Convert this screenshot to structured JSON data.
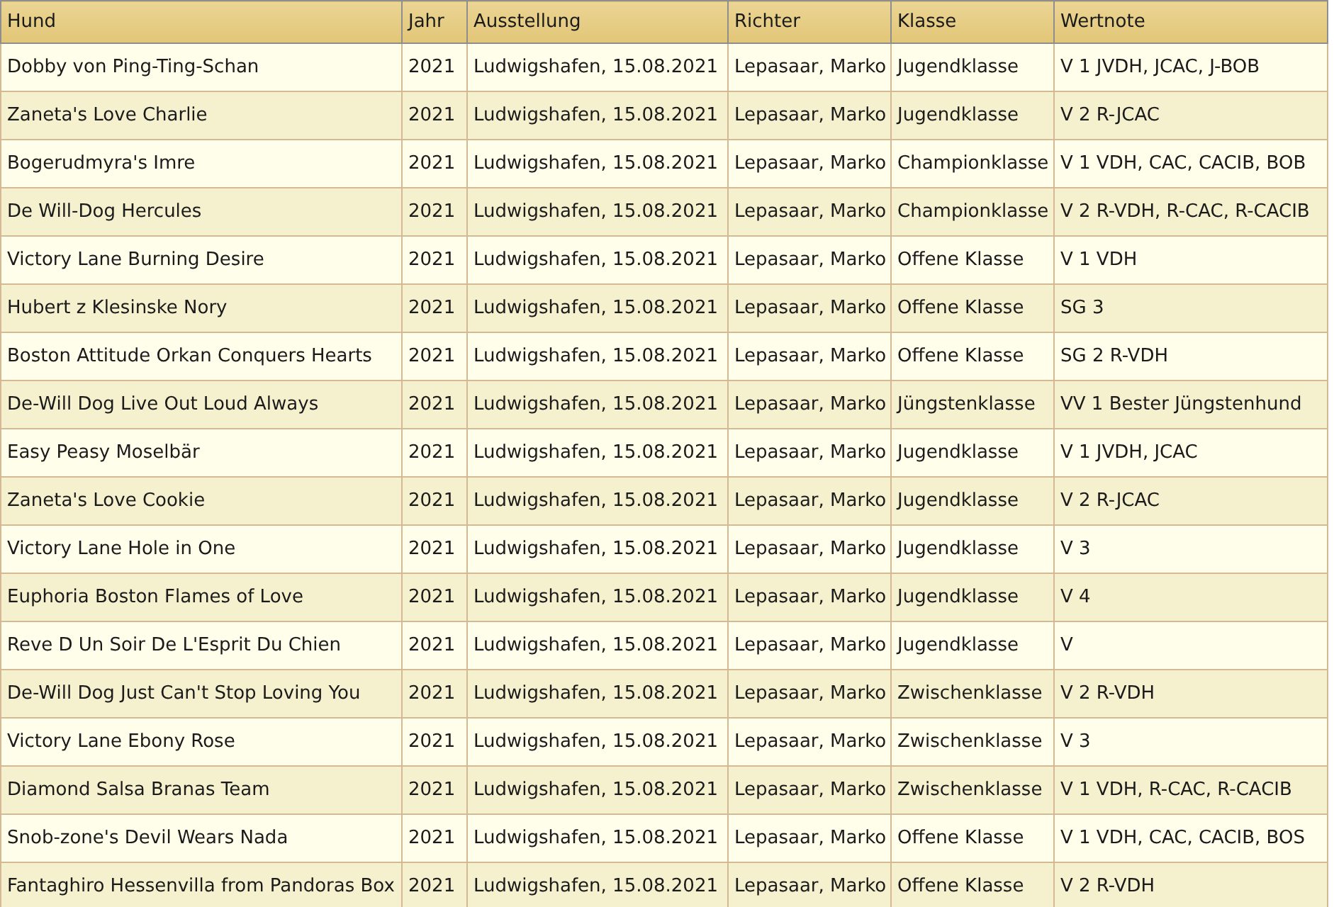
{
  "table": {
    "columns": [
      "Hund",
      "Jahr",
      "Ausstellung",
      "Richter",
      "Klasse",
      "Wertnote"
    ],
    "rows": [
      [
        "Dobby von Ping-Ting-Schan",
        "2021",
        "Ludwigshafen, 15.08.2021",
        "Lepasaar, Marko",
        "Jugendklasse",
        "V 1 JVDH, JCAC, J-BOB"
      ],
      [
        "Zaneta's Love Charlie",
        "2021",
        "Ludwigshafen, 15.08.2021",
        "Lepasaar, Marko",
        "Jugendklasse",
        "V 2 R-JCAC"
      ],
      [
        "Bogerudmyra's Imre",
        "2021",
        "Ludwigshafen, 15.08.2021",
        "Lepasaar, Marko",
        "Championklasse",
        "V 1 VDH, CAC, CACIB, BOB"
      ],
      [
        "De Will-Dog Hercules",
        "2021",
        "Ludwigshafen, 15.08.2021",
        "Lepasaar, Marko",
        "Championklasse",
        "V 2 R-VDH, R-CAC, R-CACIB"
      ],
      [
        "Victory Lane Burning Desire",
        "2021",
        "Ludwigshafen, 15.08.2021",
        "Lepasaar, Marko",
        "Offene Klasse",
        "V 1 VDH"
      ],
      [
        "Hubert z Klesinske Nory",
        "2021",
        "Ludwigshafen, 15.08.2021",
        "Lepasaar, Marko",
        "Offene Klasse",
        "SG 3"
      ],
      [
        "Boston Attitude Orkan Conquers Hearts",
        "2021",
        "Ludwigshafen, 15.08.2021",
        "Lepasaar, Marko",
        "Offene Klasse",
        "SG 2 R-VDH"
      ],
      [
        "De-Will Dog Live Out Loud Always",
        "2021",
        "Ludwigshafen, 15.08.2021",
        "Lepasaar, Marko",
        "Jüngstenklasse",
        "VV 1 Bester Jüngstenhund"
      ],
      [
        "Easy Peasy Moselbär",
        "2021",
        "Ludwigshafen, 15.08.2021",
        "Lepasaar, Marko",
        "Jugendklasse",
        "V 1 JVDH, JCAC"
      ],
      [
        "Zaneta's Love Cookie",
        "2021",
        "Ludwigshafen, 15.08.2021",
        "Lepasaar, Marko",
        "Jugendklasse",
        "V 2 R-JCAC"
      ],
      [
        "Victory Lane Hole in One",
        "2021",
        "Ludwigshafen, 15.08.2021",
        "Lepasaar, Marko",
        "Jugendklasse",
        "V 3"
      ],
      [
        "Euphoria Boston Flames of Love",
        "2021",
        "Ludwigshafen, 15.08.2021",
        "Lepasaar, Marko",
        "Jugendklasse",
        "V 4"
      ],
      [
        "Reve D Un Soir De L'Esprit Du Chien",
        "2021",
        "Ludwigshafen, 15.08.2021",
        "Lepasaar, Marko",
        "Jugendklasse",
        "V"
      ],
      [
        "De-Will Dog Just Can't Stop Loving You",
        "2021",
        "Ludwigshafen, 15.08.2021",
        "Lepasaar, Marko",
        "Zwischenklasse",
        "V 2 R-VDH"
      ],
      [
        "Victory Lane Ebony Rose",
        "2021",
        "Ludwigshafen, 15.08.2021",
        "Lepasaar, Marko",
        "Zwischenklasse",
        "V 3"
      ],
      [
        "Diamond Salsa Branas Team",
        "2021",
        "Ludwigshafen, 15.08.2021",
        "Lepasaar, Marko",
        "Zwischenklasse",
        "V 1 VDH, R-CAC, R-CACIB"
      ],
      [
        "Snob-zone's Devil Wears Nada",
        "2021",
        "Ludwigshafen, 15.08.2021",
        "Lepasaar, Marko",
        "Offene Klasse",
        "V 1 VDH, CAC, CACIB, BOS"
      ],
      [
        "Fantaghiro Hessenvilla from Pandoras Box",
        "2021",
        "Ludwigshafen, 15.08.2021",
        "Lepasaar, Marko",
        "Offene Klasse",
        "V 2 R-VDH"
      ]
    ]
  }
}
